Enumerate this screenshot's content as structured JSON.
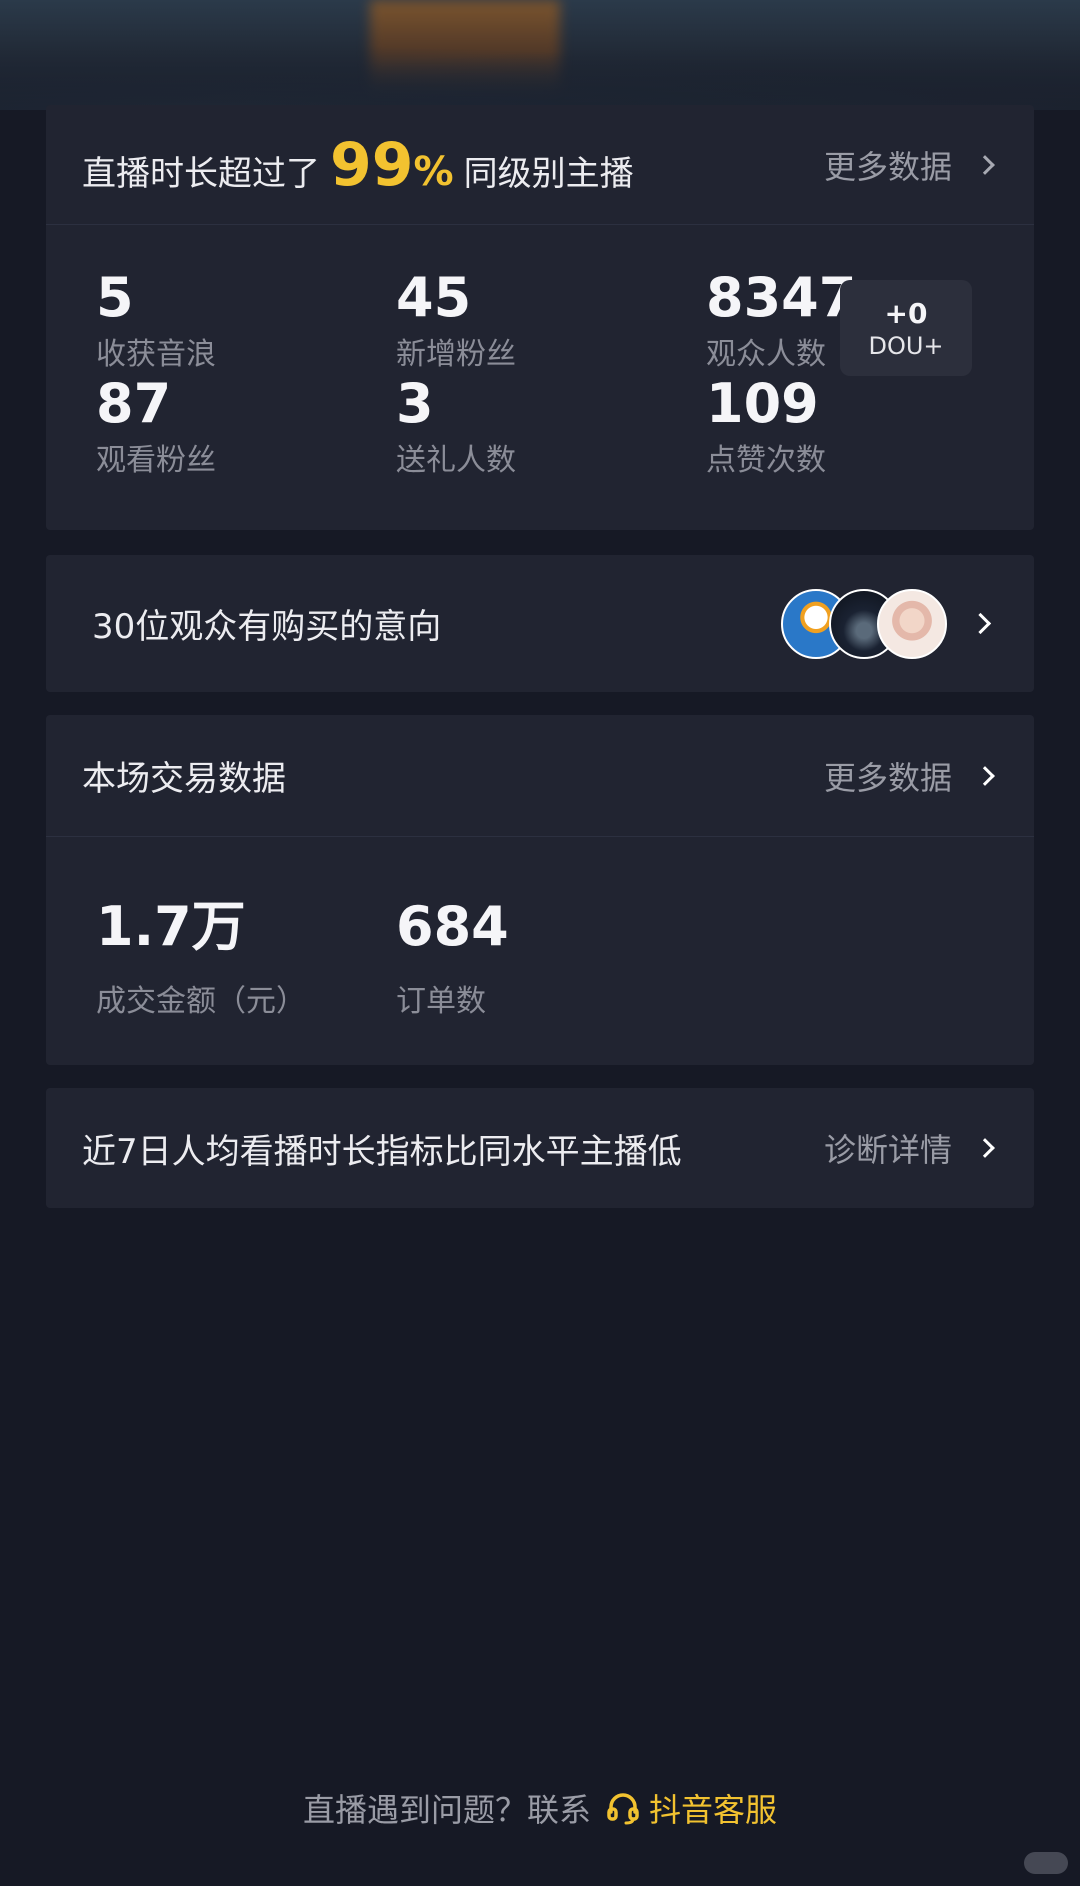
{
  "live_summary": {
    "title_prefix": "直播时长超过了",
    "percent": "99",
    "percent_sign": "%",
    "title_suffix": "同级别主播",
    "more_label": "更多数据",
    "stats": [
      {
        "value": "5",
        "label": "收获音浪"
      },
      {
        "value": "45",
        "label": "新增粉丝"
      },
      {
        "value": "8347",
        "label": "观众人数"
      },
      {
        "value": "87",
        "label": "观看粉丝"
      },
      {
        "value": "3",
        "label": "送礼人数"
      },
      {
        "value": "109",
        "label": "点赞次数"
      }
    ],
    "dou_badge": {
      "count": "+0",
      "label": "DOU+"
    }
  },
  "purchase_intent": {
    "text": "30位观众有购买的意向",
    "avatar_count": 3
  },
  "trade": {
    "title": "本场交易数据",
    "more_label": "更多数据",
    "stats": [
      {
        "value": "1.7万",
        "label": "成交金额（元）"
      },
      {
        "value": "684",
        "label": "订单数"
      }
    ]
  },
  "diagnosis": {
    "text": "近7日人均看播时长指标比同水平主播低",
    "link_label": "诊断详情"
  },
  "footer": {
    "question": "直播遇到问题？联系",
    "service_label": "抖音客服",
    "accent_color": "#f2c230"
  }
}
